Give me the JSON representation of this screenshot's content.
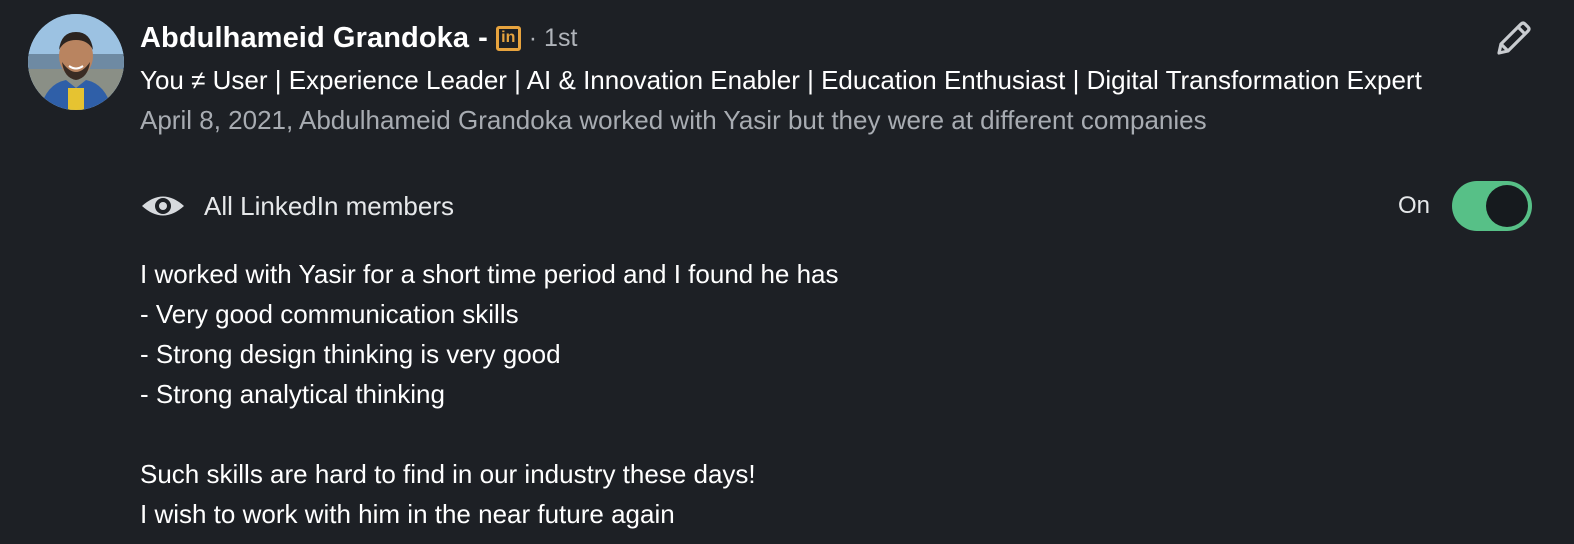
{
  "recommender": {
    "name": "Abdulhameid Grandoka",
    "name_separator": "-",
    "badge_text": "in",
    "degree": "· 1st",
    "headline": "You ≠ User | Experience Leader | AI & Innovation Enabler | Education Enthusiast | Digital Transformation Expert",
    "relation": "April 8, 2021, Abdulhameid Grandoka worked with Yasir but they were at different companies"
  },
  "visibility": {
    "label": "All LinkedIn members",
    "icon": "eye-icon",
    "toggle_state": "On",
    "toggle_on": true,
    "toggle_color": "#57c087"
  },
  "actions": {
    "edit_icon": "pencil-icon"
  },
  "recommendation": {
    "lines": [
      "I worked with Yasir for a short time period and I found he has",
      "- Very good communication skills",
      "- Strong design thinking is very good",
      "- Strong analytical thinking",
      "",
      "Such skills are hard to find in our industry these days!",
      "I wish to work with him in the near future again"
    ]
  },
  "theme": {
    "background": "#1d2025",
    "muted_text": "#a8acb2",
    "badge_color": "#e7a33e"
  }
}
